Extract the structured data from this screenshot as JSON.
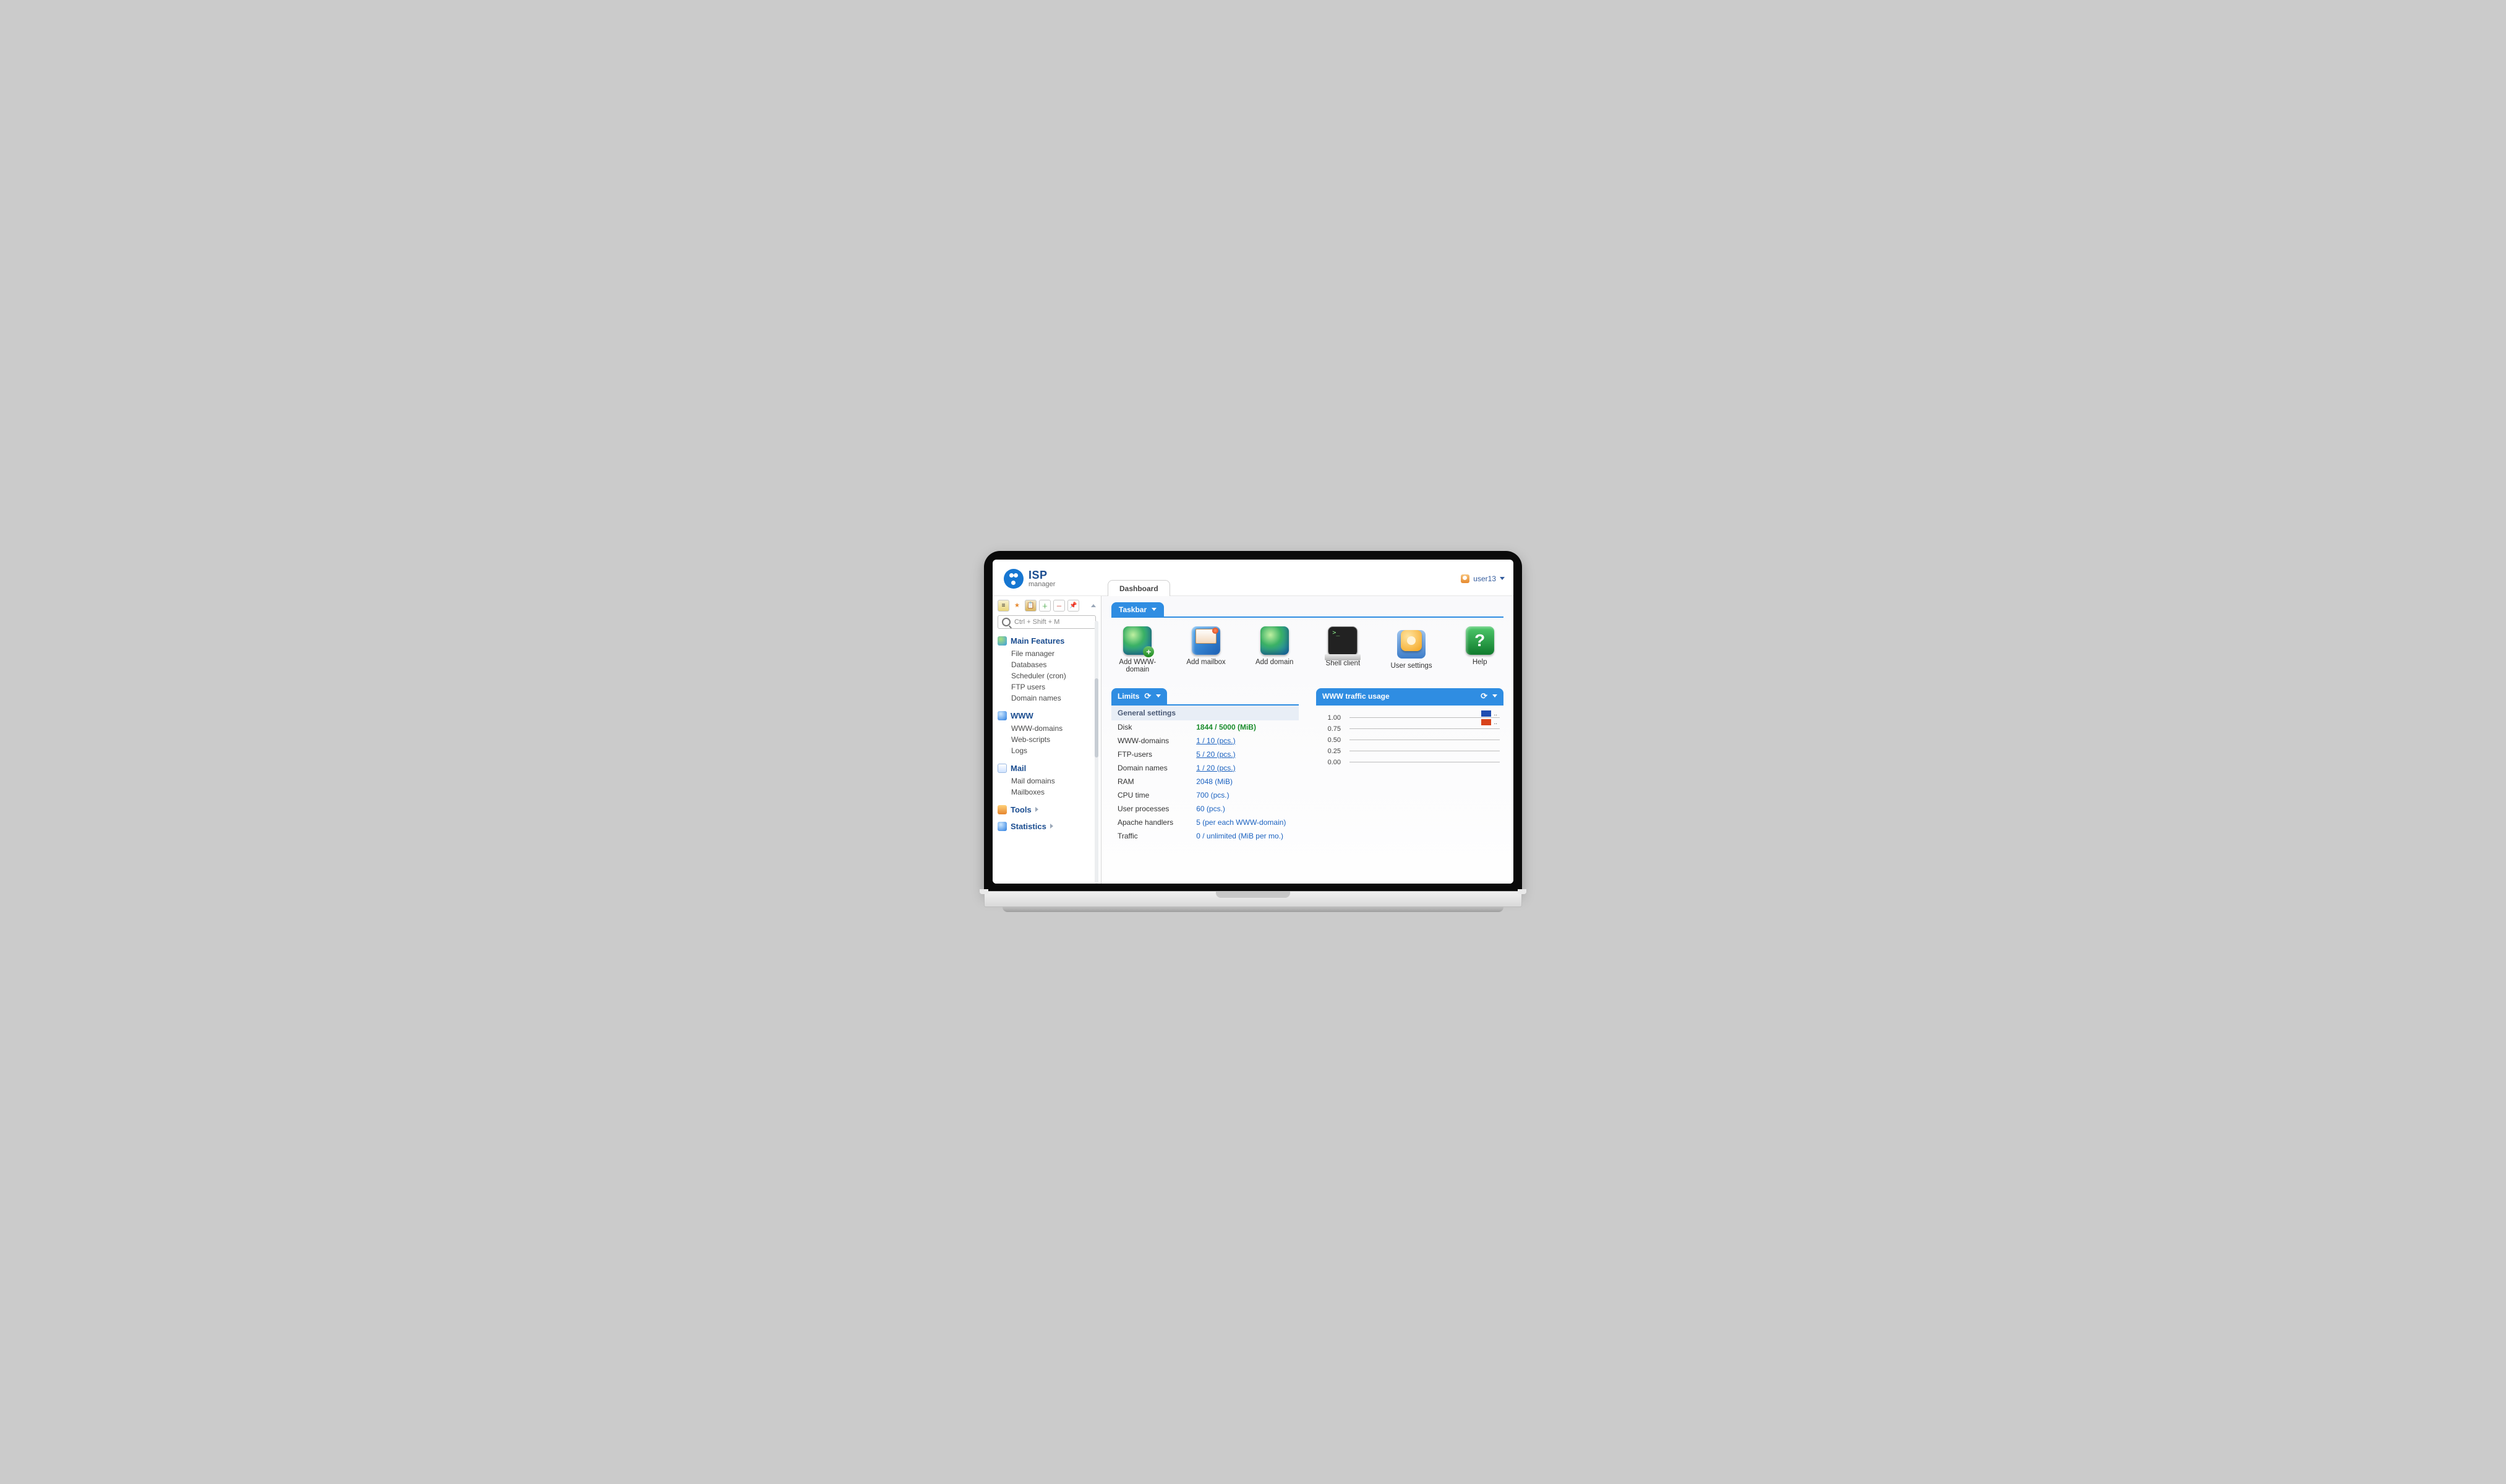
{
  "brand": {
    "name": "ISP",
    "sub": "manager"
  },
  "user": {
    "name": "user13"
  },
  "tabs": {
    "dashboard": "Dashboard"
  },
  "search": {
    "placeholder": "Ctrl + Shift + M"
  },
  "nav": {
    "main": {
      "title": "Main Features",
      "items": [
        "File manager",
        "Databases",
        "Scheduler (cron)",
        "FTP users",
        "Domain names"
      ]
    },
    "www": {
      "title": "WWW",
      "items": [
        "WWW-domains",
        "Web-scripts",
        "Logs"
      ]
    },
    "mail": {
      "title": "Mail",
      "items": [
        "Mail domains",
        "Mailboxes"
      ]
    },
    "tools": {
      "title": "Tools"
    },
    "stats": {
      "title": "Statistics"
    }
  },
  "taskbar": {
    "label": "Taskbar",
    "items": [
      "Add WWW-domain",
      "Add mailbox",
      "Add domain",
      "Shell client",
      "User settings",
      "Help"
    ]
  },
  "limits": {
    "label": "Limits",
    "section": "General settings",
    "rows": [
      {
        "k": "Disk",
        "v": "1844 / 5000 (MiB)",
        "style": "green"
      },
      {
        "k": "WWW-domains",
        "v": "1 / 10 (pcs.)",
        "style": "link"
      },
      {
        "k": "FTP-users",
        "v": "5 / 20 (pcs.)",
        "style": "link"
      },
      {
        "k": "Domain names",
        "v": "1 / 20 (pcs.)",
        "style": "link"
      },
      {
        "k": "RAM",
        "v": "2048 (MiB)",
        "style": "blue"
      },
      {
        "k": "CPU time",
        "v": "700 (pcs.)",
        "style": "blue"
      },
      {
        "k": "User processes",
        "v": "60 (pcs.)",
        "style": "blue"
      },
      {
        "k": "Apache handlers",
        "v": "5 (per each WWW-domain)",
        "style": "blue"
      },
      {
        "k": "Traffic",
        "v": "0 / unlimited (MiB per mo.)",
        "style": "blue"
      }
    ]
  },
  "traffic": {
    "label": "WWW traffic usage",
    "ticks": [
      "1.00",
      "0.75",
      "0.50",
      "0.25",
      "0.00"
    ],
    "legend": [
      {
        "color": "#1f4db1",
        "label": ".."
      },
      {
        "color": "#d8431b",
        "label": ".."
      }
    ]
  },
  "chart_data": {
    "type": "line",
    "title": "WWW traffic usage",
    "ylim": [
      0,
      1
    ],
    "yticks": [
      0.0,
      0.25,
      0.5,
      0.75,
      1.0
    ],
    "series": [
      {
        "name": "..",
        "color": "#1f4db1",
        "values": []
      },
      {
        "name": "..",
        "color": "#d8431b",
        "values": []
      }
    ]
  }
}
